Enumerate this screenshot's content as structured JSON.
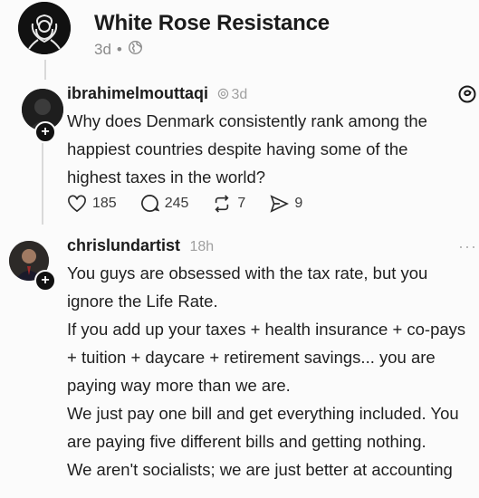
{
  "header": {
    "title": "White Rose Resistance",
    "age": "3d",
    "sep": "•"
  },
  "posts": [
    {
      "username": "ibrahimelmouttaqi",
      "time": "3d",
      "text": "Why does Denmark consistently rank among the happiest countries despite having some of the highest taxes in the world?",
      "likes": "185",
      "comments": "245",
      "reposts": "7",
      "shares": "9"
    },
    {
      "username": "chrislundartist",
      "time": "18h",
      "lines": [
        "You guys are obsessed with the tax rate, but you ignore the Life Rate.",
        "If you add up your taxes + health insurance + co-pays + tuition + daycare + retirement savings... you are paying way more than we are.",
        "We just pay one bill and get everything included. You are paying five different bills and getting nothing.",
        "We aren't socialists; we are just better at accounting"
      ]
    }
  ],
  "icons": {
    "globe": "globe-icon",
    "threads": "threads-logo-icon",
    "more": "more-icon",
    "heart": "heart-icon",
    "comment": "comment-icon",
    "repost": "repost-icon",
    "share": "share-icon"
  }
}
